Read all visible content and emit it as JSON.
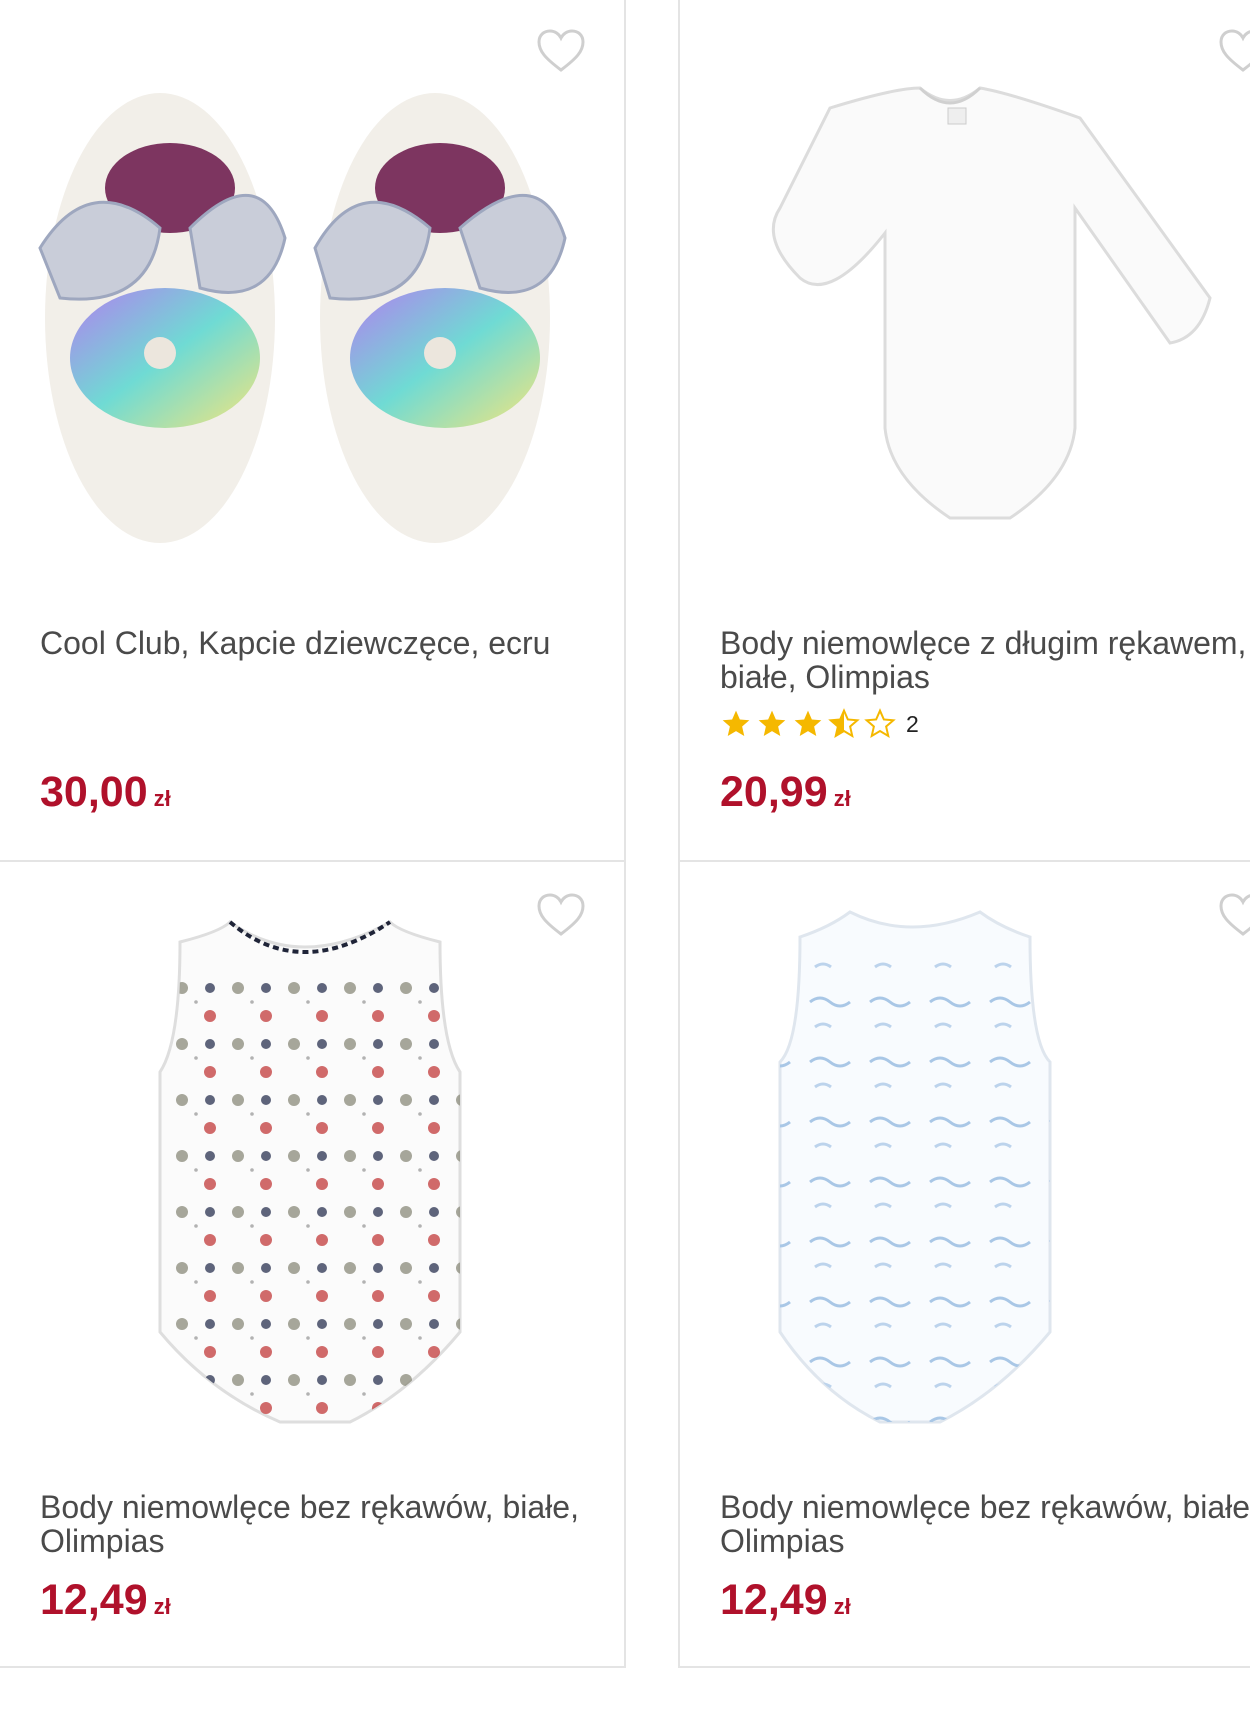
{
  "products": [
    {
      "title": "Cool Club, Kapcie dziewczęce, ecru",
      "price": "30,00",
      "currency": "zł",
      "image": "fairy-wing-slippers"
    },
    {
      "title": "Body niemowlęce z długim rękawem, białe, Olimpias",
      "price": "20,99",
      "currency": "zł",
      "image": "long-sleeve-bodysuit",
      "rating": {
        "stars": 3.5,
        "max": 5,
        "count": "2"
      }
    },
    {
      "title": "Body niemowlęce bez rękawów, białe, Olimpias",
      "price": "12,49",
      "currency": "zł",
      "image": "patterned-sleeveless-bodysuit"
    },
    {
      "title": "Body niemowlęce bez rękawów, białe, Olimpias",
      "price": "12,49",
      "currency": "zł",
      "image": "blue-print-sleeveless-bodysuit"
    }
  ],
  "icons": {
    "favorite": "heart-outline-icon",
    "star": "star-icon"
  },
  "colors": {
    "price": "#b0112b",
    "star": "#f5b800",
    "heart": "#cfcfcf",
    "border": "#e4e4e4"
  }
}
